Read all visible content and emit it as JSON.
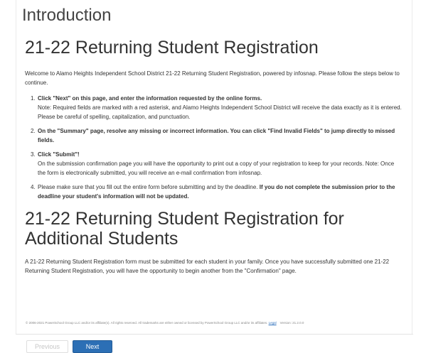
{
  "page": {
    "title": "Introduction"
  },
  "section1": {
    "title": "21-22 Returning Student Registration",
    "welcome": "Welcome to Alamo Heights Independent School District 21-22 Returning Student Registration, powered by infosnap.  Please follow the steps below to continue."
  },
  "steps": [
    {
      "num": "1.",
      "bold": "Click \"Next\" on this page, and enter the information requested by the online forms.",
      "text": "Note: Required fields are marked with a red asterisk, and Alamo Heights Independent School District will receive the data exactly as it is entered.  Please be careful of spelling, capitalization, and punctuation."
    },
    {
      "num": "2.",
      "bold": "On the \"Summary\" page, resolve any missing or incorrect information. You can click \"Find Invalid Fields\" to jump directly to missed fields.",
      "text": ""
    },
    {
      "num": "3.",
      "bold": "Click \"Submit\"!",
      "text": "On the submission confirmation page you will have the opportunity to print out a copy of your registration to keep for your records.  Note: Once the form is electronically submitted, you will receive an e-mail confirmation from infosnap."
    },
    {
      "num": "4.",
      "text": "Please make sure that you fill out the entire form before submitting and by the deadline. ",
      "bold": "If you do not complete the submission prior to the deadline your student's information will not be updated."
    }
  ],
  "section2": {
    "title": "21-22 Returning Student Registration for Additional Students",
    "text": "A 21-22 Returning Student Registration form must be submitted for each student in your family. Once you have successfully submitted one 21-22 Returning Student Registration, you will have the opportunity to begin another from the \"Confirmation\" page."
  },
  "footer": {
    "copyright": "© 2006-2021 PowerSchool Group LLC and/or its affiliate(s). All rights reserved. All trademarks are either owned or licensed by PowerSchool Group LLC and/or its affiliates.",
    "legal": "Legal",
    "version": "Version: 21.2.0.0"
  },
  "nav": {
    "previous": "Previous",
    "next": "Next"
  }
}
